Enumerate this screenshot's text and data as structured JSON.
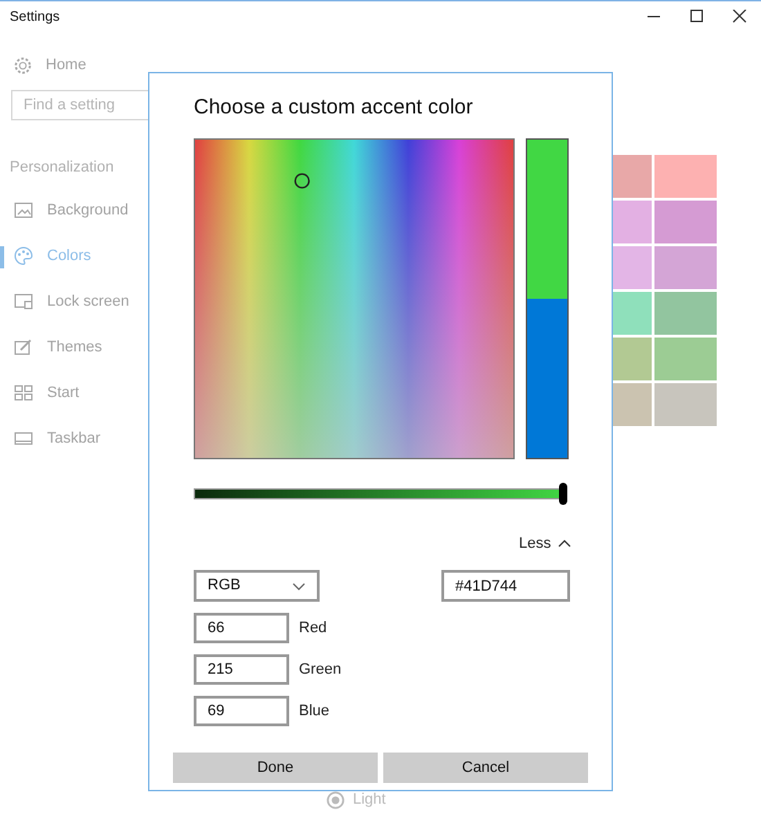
{
  "window": {
    "title": "Settings"
  },
  "sidebar": {
    "home": "Home",
    "search": {
      "placeholder": "Find a setting"
    },
    "section": "Personalization",
    "items": [
      {
        "label": "Background",
        "selected": false
      },
      {
        "label": "Colors",
        "selected": true
      },
      {
        "label": "Lock screen",
        "selected": false
      },
      {
        "label": "Themes",
        "selected": false
      },
      {
        "label": "Start",
        "selected": false
      },
      {
        "label": "Taskbar",
        "selected": false
      }
    ]
  },
  "page": {
    "swatches": [
      {
        "color": "#e8a8a8"
      },
      {
        "color": "#fdb1b1"
      },
      {
        "color": "#e3b0e3"
      },
      {
        "color": "#d59bd3"
      },
      {
        "color": "#e3b5e6"
      },
      {
        "color": "#d4a5d6"
      },
      {
        "color": "#8fe0bb"
      },
      {
        "color": "#92c59f"
      },
      {
        "color": "#b2c993"
      },
      {
        "color": "#9ccc94"
      },
      {
        "color": "#cbc3b0"
      },
      {
        "color": "#c8c5bd"
      }
    ],
    "mode_option": {
      "label": "Light",
      "selected": true
    }
  },
  "dialog": {
    "title": "Choose a custom accent color",
    "preview": [
      {
        "color": "#41d744"
      },
      {
        "color": "#0078d7"
      }
    ],
    "brightness": {
      "level": 1
    },
    "toggle": "Less",
    "model": "RGB",
    "hex": "#41D744",
    "channels": [
      {
        "value": "66",
        "label": "Red"
      },
      {
        "value": "215",
        "label": "Green"
      },
      {
        "value": "69",
        "label": "Blue"
      }
    ],
    "buttons": [
      "Done",
      "Cancel"
    ]
  }
}
